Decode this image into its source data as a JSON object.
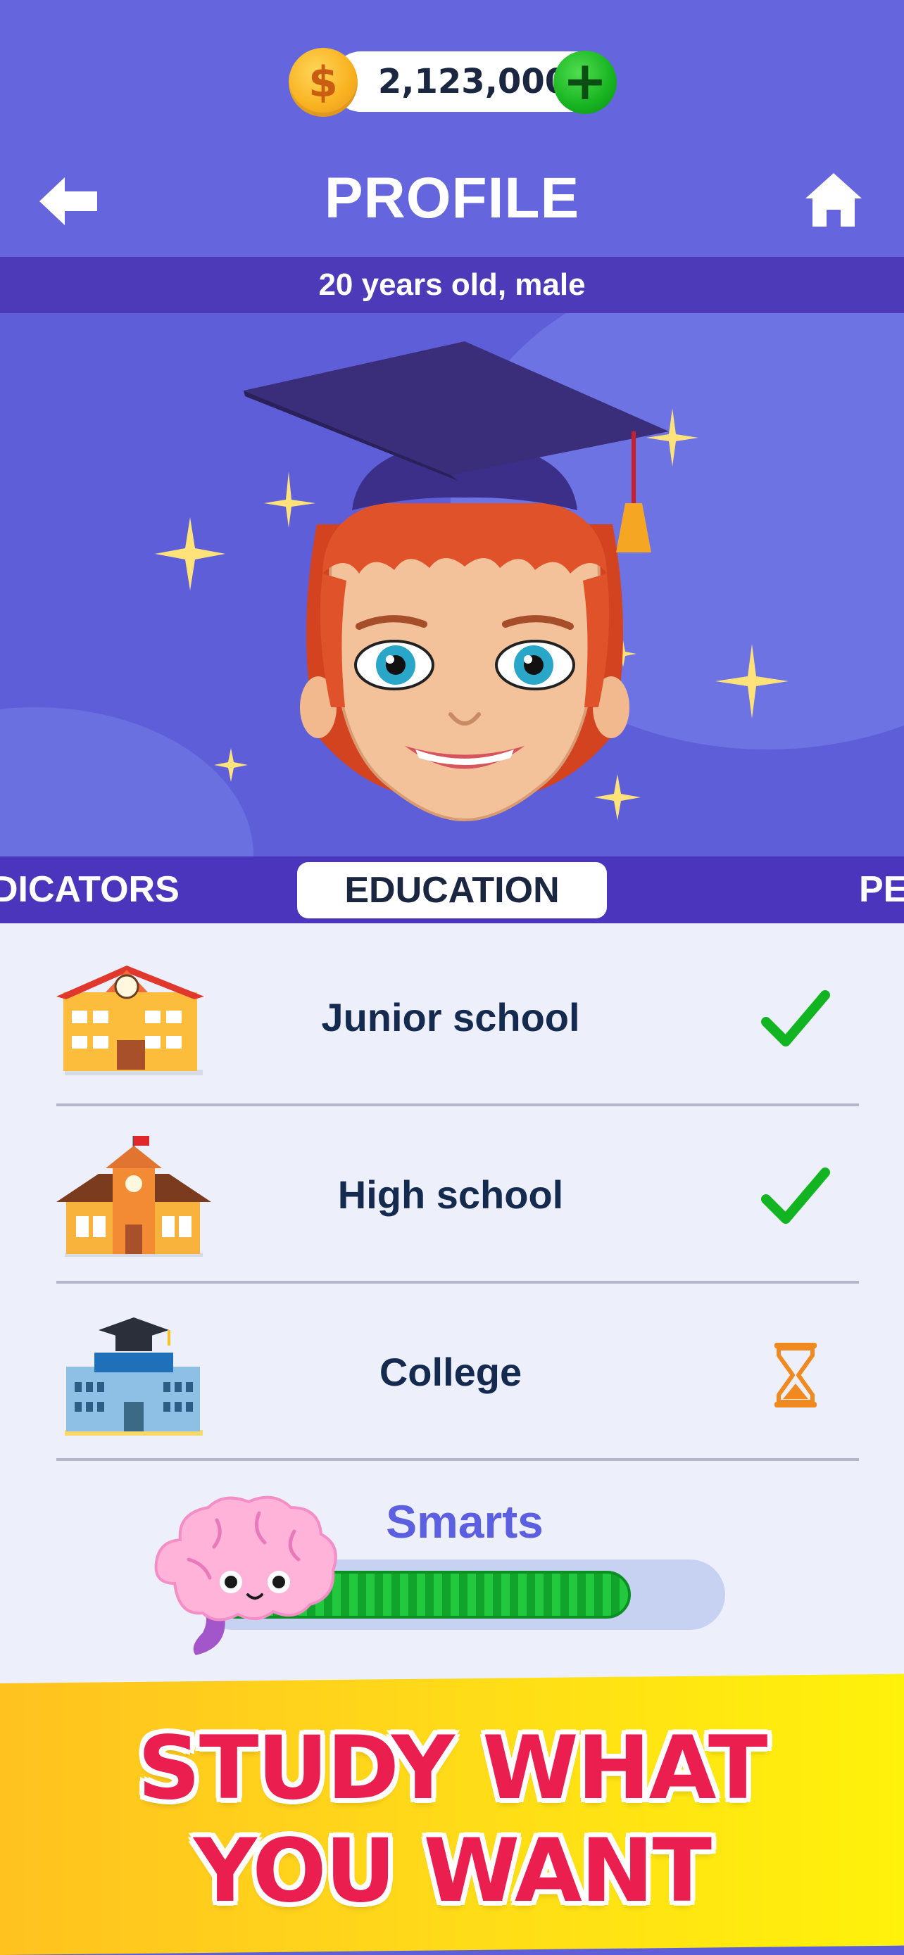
{
  "header": {
    "coins": "2,123,000",
    "coin_symbol": "$",
    "add_symbol": "+",
    "title": "PROFILE",
    "subtitle": "20 years old, male"
  },
  "tabs": [
    {
      "label": "DICATORS",
      "active": false
    },
    {
      "label": "EDUCATION",
      "active": true
    },
    {
      "label": "PE",
      "active": false
    }
  ],
  "education": [
    {
      "label": "Junior school",
      "status": "completed",
      "icon": "junior-school-building-icon"
    },
    {
      "label": "High school",
      "status": "completed",
      "icon": "high-school-building-icon"
    },
    {
      "label": "College",
      "status": "in-progress",
      "icon": "college-building-icon"
    }
  ],
  "smarts": {
    "label": "Smarts",
    "progress": 0.84,
    "icon": "brain-icon"
  },
  "banner": {
    "line1": "STUDY WHAT",
    "line2": "YOU WANT"
  },
  "colors": {
    "header_bg": "#6565dd",
    "band_bg": "#4d3ab8",
    "accent_green": "#17b320",
    "banner_text": "#ea1f4f",
    "banner_bg": "#ffd81a"
  }
}
